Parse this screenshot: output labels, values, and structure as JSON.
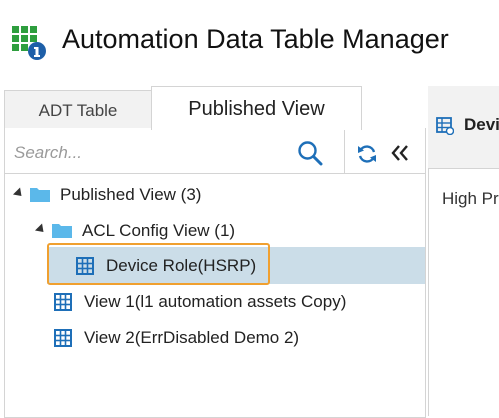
{
  "app": {
    "title": "Automation Data Table Manager"
  },
  "tabs": [
    {
      "label": "ADT Table",
      "active": false
    },
    {
      "label": "Published View",
      "active": true
    }
  ],
  "search": {
    "placeholder": "Search...",
    "value": ""
  },
  "tree": {
    "root": {
      "label": "Published View (3)",
      "expanded": true,
      "icon": "folder-icon"
    },
    "folder": {
      "label": "ACL Config View (1)",
      "expanded": true,
      "icon": "folder-icon"
    },
    "items": [
      {
        "label": "Device Role(HSRP)",
        "selected": true,
        "icon": "table-icon"
      },
      {
        "label": "View 1(l1 automation assets Copy)",
        "selected": false,
        "icon": "table-icon"
      },
      {
        "label": "View 2(ErrDisabled Demo 2)",
        "selected": false,
        "icon": "table-icon"
      }
    ]
  },
  "right_panel": {
    "header": "Devi",
    "content": "High Pr"
  },
  "colors": {
    "accent_blue": "#1e6fb8",
    "folder_blue": "#5bb8ea",
    "selection": "#cbdde8",
    "highlight_orange": "#f0a030",
    "app_icon_green": "#2e9e3e"
  }
}
